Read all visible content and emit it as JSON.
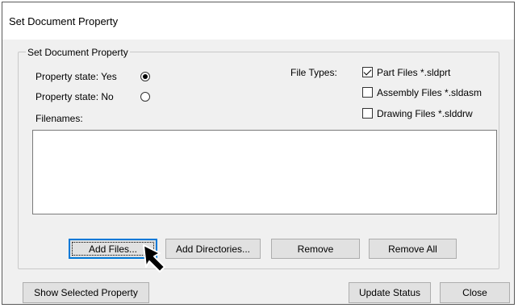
{
  "window": {
    "title": "Set Document Property"
  },
  "group": {
    "title": "Set Document Property"
  },
  "property_state": {
    "yes_label": "Property state: Yes",
    "no_label": "Property state: No",
    "selected": "yes"
  },
  "file_types": {
    "label": "File Types:",
    "options": [
      {
        "label": "Part Files *.sldprt",
        "checked": true
      },
      {
        "label": "Assembly Files *.sldasm",
        "checked": false
      },
      {
        "label": "Drawing Files *.slddrw",
        "checked": false
      }
    ]
  },
  "filenames": {
    "label": "Filenames:",
    "items": []
  },
  "buttons": {
    "add_files": "Add Files...",
    "add_directories": "Add Directories...",
    "remove": "Remove",
    "remove_all": "Remove All",
    "show_selected": "Show Selected Property",
    "update_status": "Update Status",
    "close": "Close"
  },
  "cursor": {
    "icon": "arrow-pointer-icon"
  }
}
